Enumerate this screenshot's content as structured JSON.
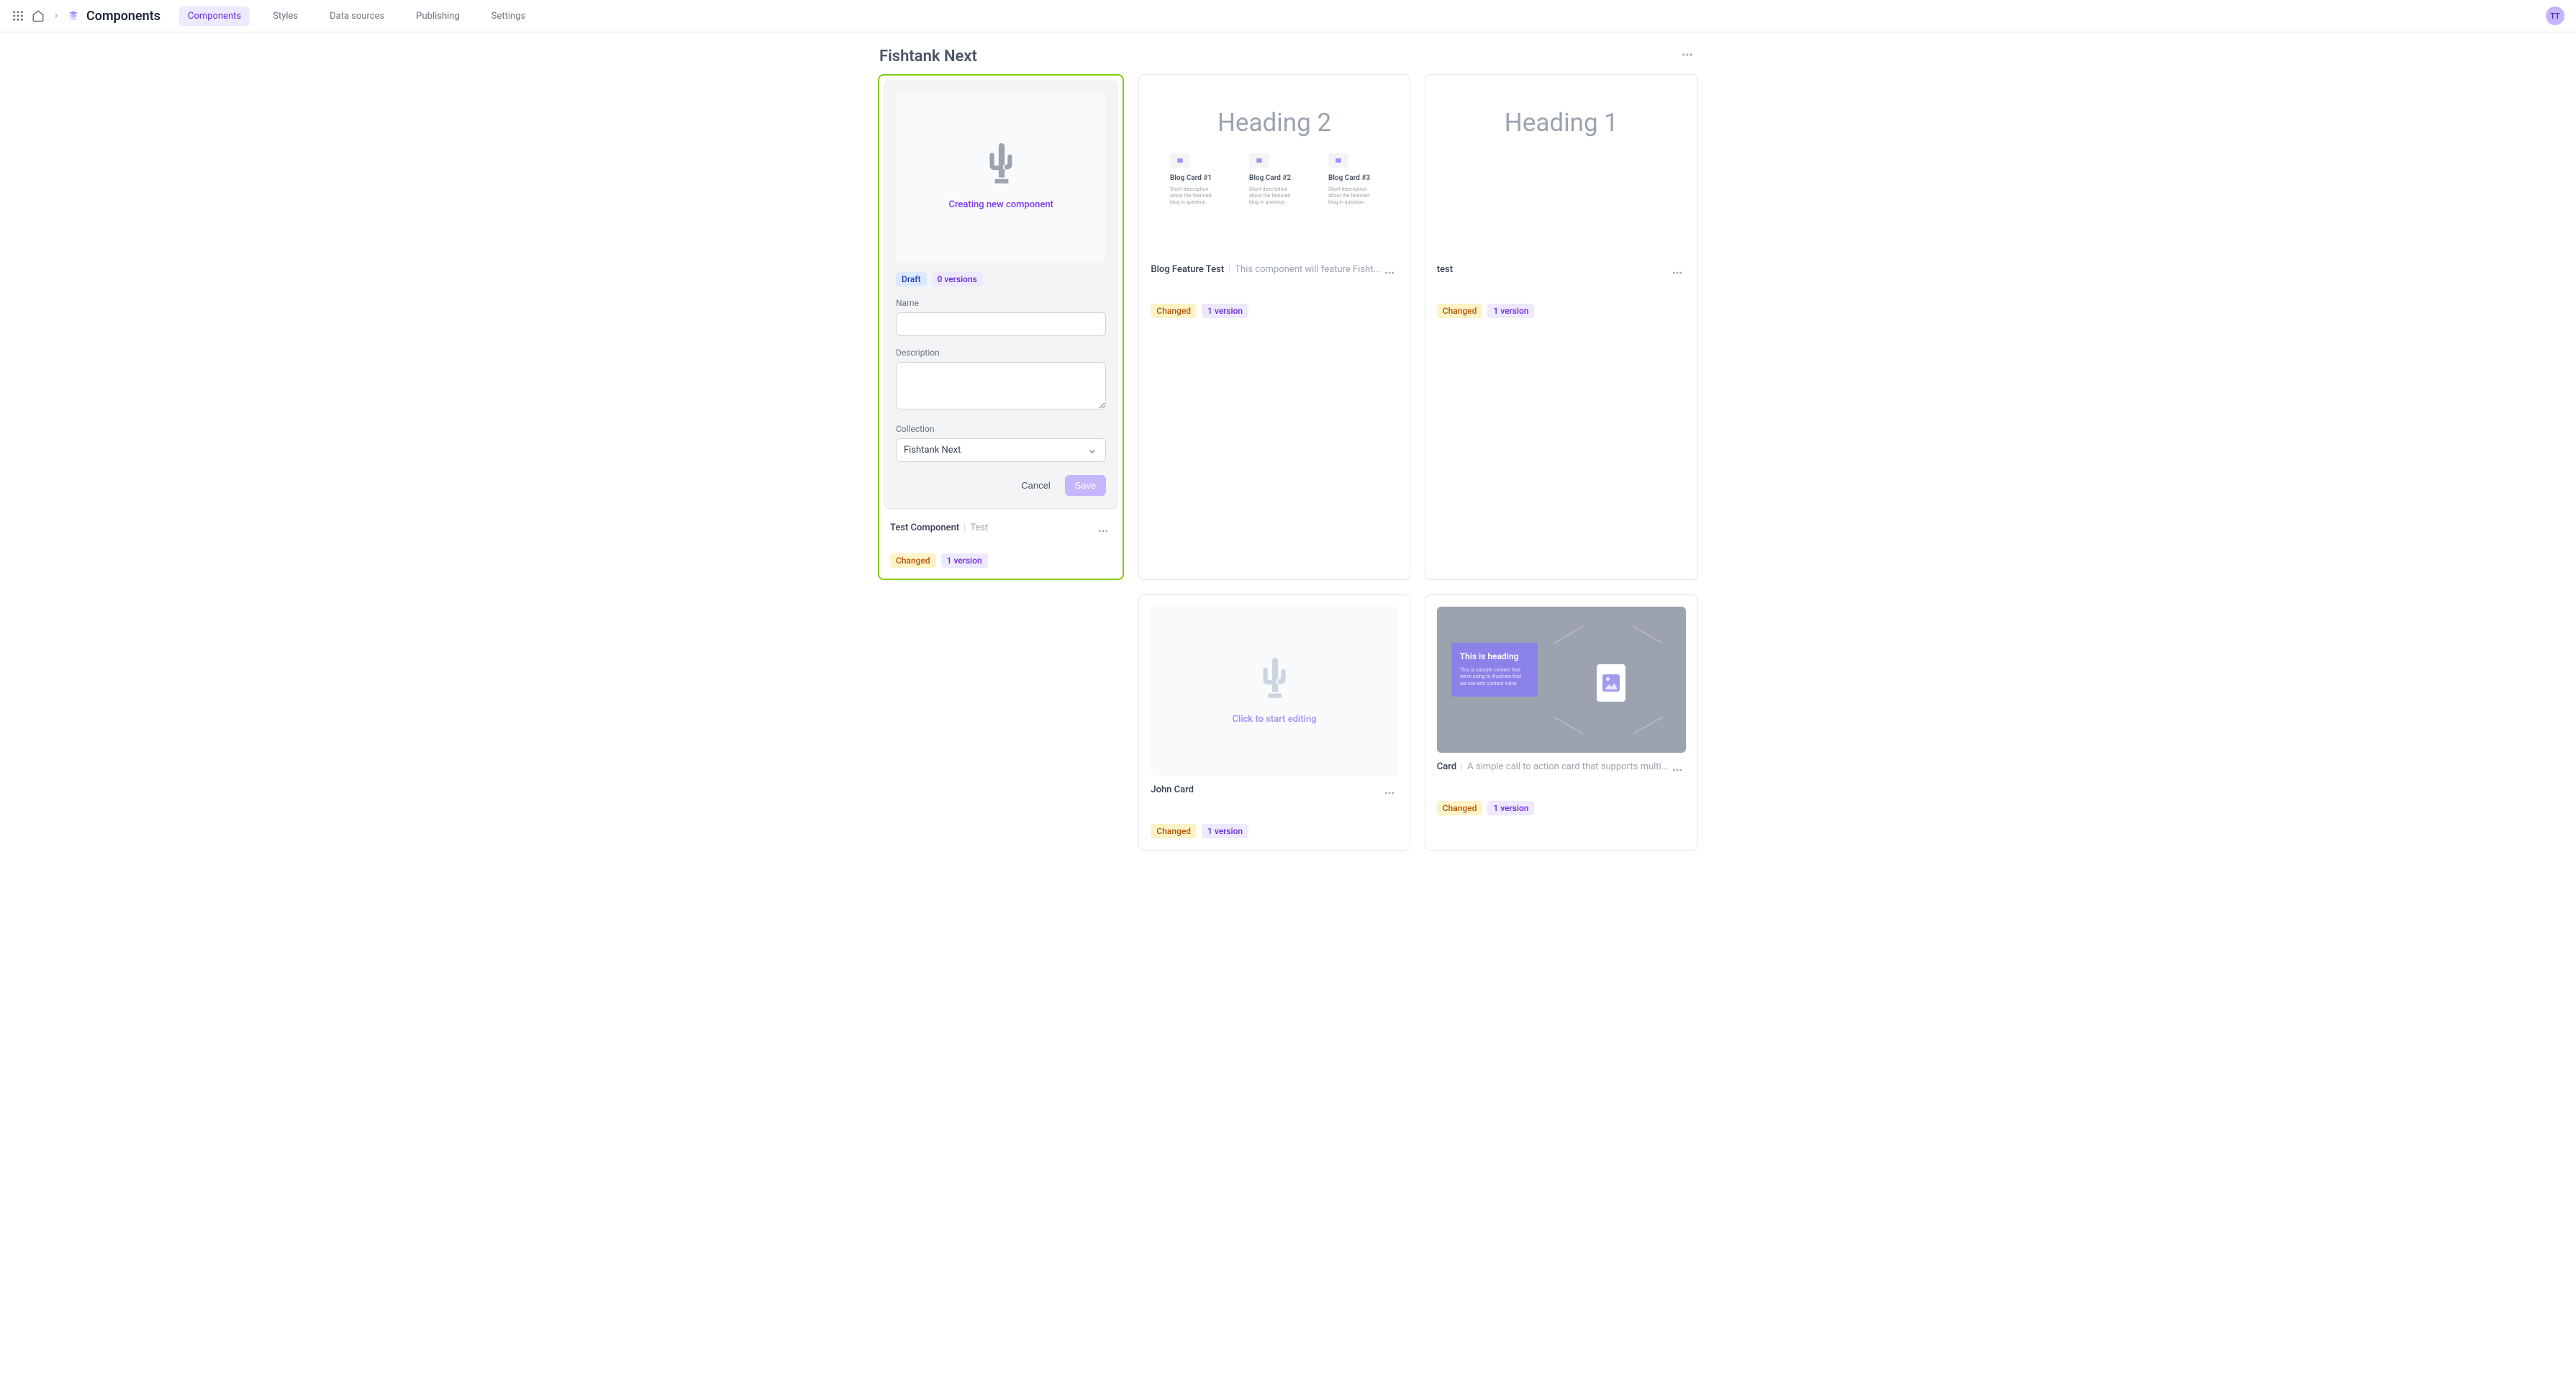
{
  "header": {
    "brand_title": "Components",
    "tabs": [
      "Components",
      "Styles",
      "Data sources",
      "Publishing",
      "Settings"
    ],
    "active_tab_index": 0,
    "avatar_initials": "TT"
  },
  "page": {
    "title": "Fishtank Next"
  },
  "new_form": {
    "preview_label": "Creating new component",
    "chips": {
      "draft": "Draft",
      "versions": "0 versions"
    },
    "labels": {
      "name": "Name",
      "description": "Description",
      "collection": "Collection"
    },
    "values": {
      "name": "",
      "description": "",
      "collection": "Fishtank Next"
    },
    "buttons": {
      "cancel": "Cancel",
      "save": "Save"
    }
  },
  "cards": {
    "test_component": {
      "name": "Test Component",
      "desc": "Test",
      "chips": {
        "status": "Changed",
        "versions": "1 version"
      }
    },
    "blog_feature": {
      "preview_heading": "Heading 2",
      "blog_cols": [
        {
          "title": "Blog Card #1",
          "desc": "Short description about the featured blog in question."
        },
        {
          "title": "Blog Card #2",
          "desc": "Short description about the featured blog in question."
        },
        {
          "title": "Blog Card #3",
          "desc": "Short description about the featured blog in question."
        }
      ],
      "name": "Blog Feature Test",
      "desc": "This component will feature Fisht...",
      "chips": {
        "status": "Changed",
        "versions": "1 version"
      }
    },
    "heading1_test": {
      "preview_heading": "Heading 1",
      "name": "test",
      "desc": "",
      "chips": {
        "status": "Changed",
        "versions": "1 version"
      }
    },
    "john_card": {
      "name": "John Card",
      "desc": "",
      "click_text": "Click to start editing",
      "chips": {
        "status": "Changed",
        "versions": "1 version"
      }
    },
    "cta_card": {
      "cta_heading": "This is heading",
      "cta_text": "This is sample content that we're using to illustrate that we can edit content inline",
      "name": "Card",
      "desc": "A simple call to action card that supports multi...",
      "chips": {
        "status": "Changed",
        "versions": "1 version"
      }
    }
  }
}
